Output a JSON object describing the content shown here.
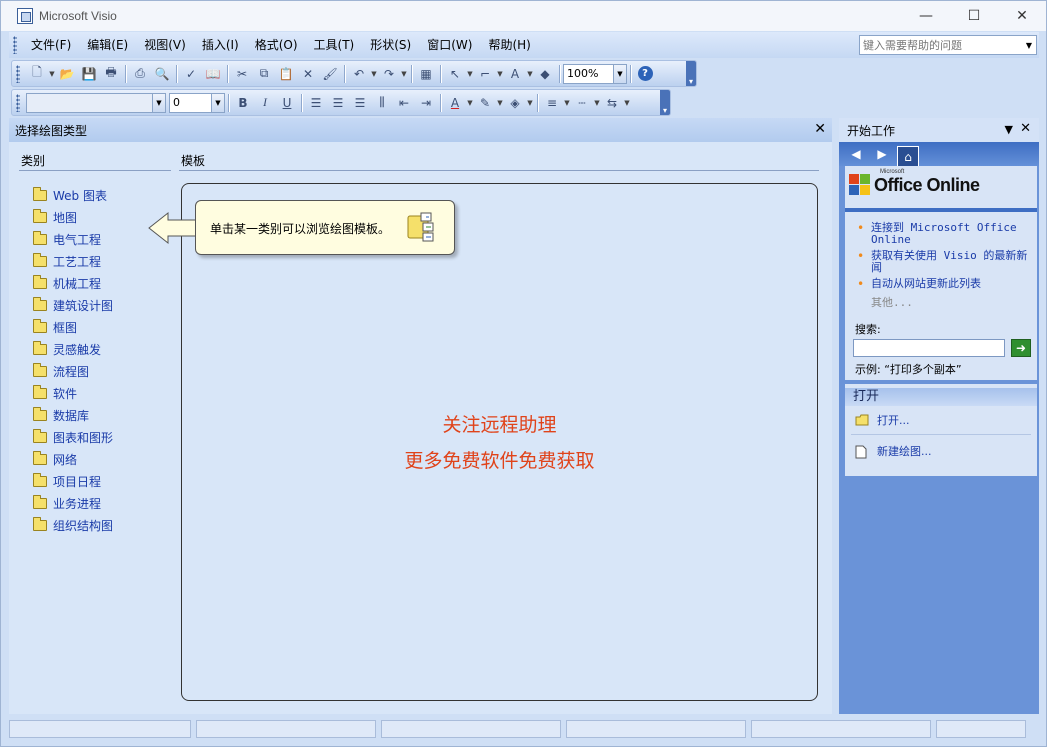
{
  "window": {
    "title": "Microsoft Visio",
    "controls": {
      "minimize": "—",
      "maximize": "☐",
      "close": "✕"
    }
  },
  "menubar": {
    "items": [
      "文件(F)",
      "编辑(E)",
      "视图(V)",
      "插入(I)",
      "格式(O)",
      "工具(T)",
      "形状(S)",
      "窗口(W)",
      "帮助(H)"
    ],
    "help_placeholder": "键入需要帮助的问题"
  },
  "toolbar1": {
    "zoom": "100%"
  },
  "toolbar2": {
    "font": "",
    "font_size": "0",
    "bold": "B",
    "italic": "I",
    "underline": "U"
  },
  "left_pane": {
    "title": "选择绘图类型",
    "category_header": "类别",
    "template_header": "模板",
    "categories": [
      "Web 图表",
      "地图",
      "电气工程",
      "工艺工程",
      "机械工程",
      "建筑设计图",
      "框图",
      "灵感触发",
      "流程图",
      "软件",
      "数据库",
      "图表和图形",
      "网络",
      "项目日程",
      "业务进程",
      "组织结构图"
    ],
    "callout": "单击某一类别可以浏览绘图模板。",
    "promo_line1": "关注远程助理",
    "promo_line2": "更多免费软件免费获取"
  },
  "task_pane": {
    "title": "开始工作",
    "logo_small": "Microsoft",
    "logo_main": "Office Online",
    "links": [
      "连接到 Microsoft Office Online",
      "获取有关使用 Visio 的最新新闻",
      "自动从网站更新此列表"
    ],
    "more": "其他...",
    "search_label": "搜索:",
    "search_value": "",
    "example": "示例: “打印多个副本”",
    "open_header": "打开",
    "open_link": "打开...",
    "new_link": "新建绘图..."
  },
  "colors": {
    "promo": "#e0431a",
    "link": "#1a3ba8",
    "bullet": "#f08a1c",
    "task_pane_bg": "#6a93d8"
  }
}
